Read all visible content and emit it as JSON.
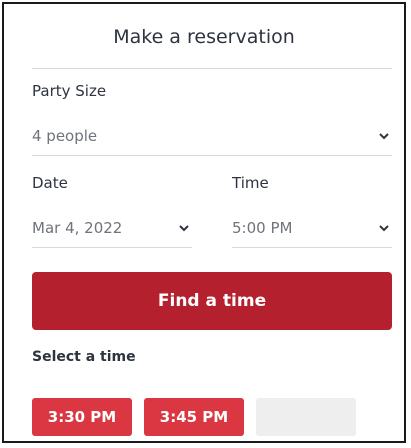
{
  "widget": {
    "title": "Make a reservation",
    "party_size": {
      "label": "Party Size",
      "value": "4 people"
    },
    "date": {
      "label": "Date",
      "value": "Mar 4, 2022"
    },
    "time": {
      "label": "Time",
      "value": "5:00 PM"
    },
    "find_button_label": "Find a time",
    "select_time_label": "Select a time",
    "slots": [
      "3:30 PM",
      "3:45 PM",
      ""
    ]
  },
  "colors": {
    "primary_button": "#b5202e",
    "slot_button": "#da3743",
    "slot_empty": "#eeeeee"
  },
  "icons": [
    "chevron-down-icon"
  ]
}
